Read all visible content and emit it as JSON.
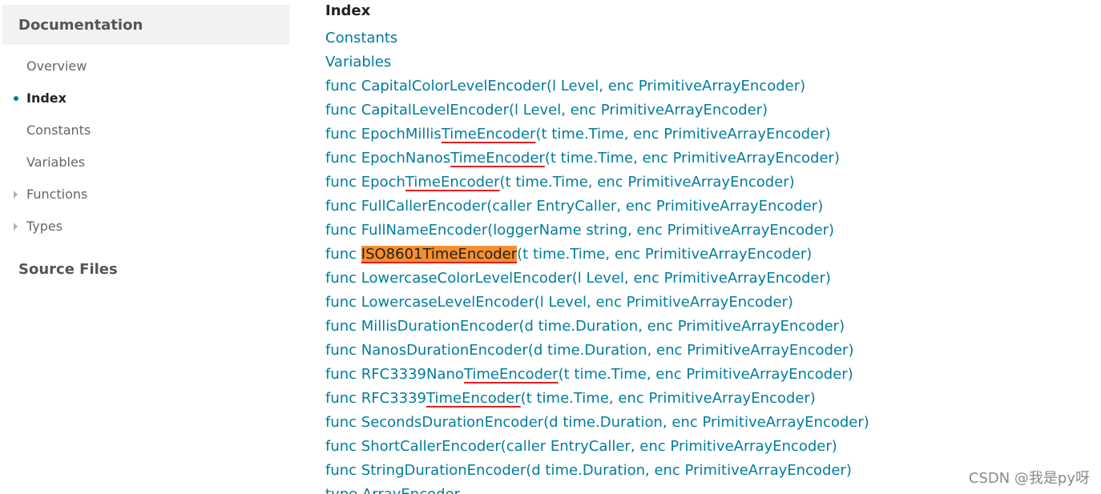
{
  "sidebar": {
    "title": "Documentation",
    "items": [
      {
        "label": "Overview"
      },
      {
        "label": "Index",
        "active": true
      },
      {
        "label": "Constants"
      },
      {
        "label": "Variables"
      },
      {
        "label": "Functions",
        "expandable": true
      },
      {
        "label": "Types",
        "expandable": true
      }
    ],
    "source_files": "Source Files"
  },
  "main": {
    "heading": "Index",
    "items": [
      {
        "text": "Constants"
      },
      {
        "text": "Variables"
      },
      {
        "text": "func CapitalColorLevelEncoder(l Level, enc PrimitiveArrayEncoder)"
      },
      {
        "text": "func CapitalLevelEncoder(l Level, enc PrimitiveArrayEncoder)"
      },
      {
        "pre": "func EpochMillis",
        "em": "TimeEncoder",
        "post": "(t time.Time, enc PrimitiveArrayEncoder)"
      },
      {
        "pre": "func EpochNanos",
        "em": "TimeEncoder",
        "post": "(t time.Time, enc PrimitiveArrayEncoder)"
      },
      {
        "pre": "func Epoch",
        "em": "TimeEncoder",
        "post": "(t time.Time, enc PrimitiveArrayEncoder)"
      },
      {
        "text": "func FullCallerEncoder(caller EntryCaller, enc PrimitiveArrayEncoder)"
      },
      {
        "text": "func FullNameEncoder(loggerName string, enc PrimitiveArrayEncoder)"
      },
      {
        "pre": "func ",
        "em": "ISO8601TimeEncoder",
        "post": "(t time.Time, enc PrimitiveArrayEncoder)",
        "highlight": true
      },
      {
        "text": "func LowercaseColorLevelEncoder(l Level, enc PrimitiveArrayEncoder)"
      },
      {
        "text": "func LowercaseLevelEncoder(l Level, enc PrimitiveArrayEncoder)"
      },
      {
        "text": "func MillisDurationEncoder(d time.Duration, enc PrimitiveArrayEncoder)"
      },
      {
        "text": "func NanosDurationEncoder(d time.Duration, enc PrimitiveArrayEncoder)"
      },
      {
        "pre": "func RFC3339Nano",
        "em": "TimeEncoder",
        "post": "(t time.Time, enc PrimitiveArrayEncoder)"
      },
      {
        "pre": "func RFC3339",
        "em": "TimeEncoder",
        "post": "(t time.Time, enc PrimitiveArrayEncoder)"
      },
      {
        "text": "func SecondsDurationEncoder(d time.Duration, enc PrimitiveArrayEncoder)"
      },
      {
        "text": "func ShortCallerEncoder(caller EntryCaller, enc PrimitiveArrayEncoder)"
      },
      {
        "text": "func StringDurationEncoder(d time.Duration, enc PrimitiveArrayEncoder)"
      },
      {
        "text": "type ArrayEncoder"
      }
    ]
  },
  "watermark": "CSDN @我是py呀",
  "colors": {
    "link": "#007d9c",
    "highlight": "#f58e2f",
    "annotation": "#e02020"
  }
}
